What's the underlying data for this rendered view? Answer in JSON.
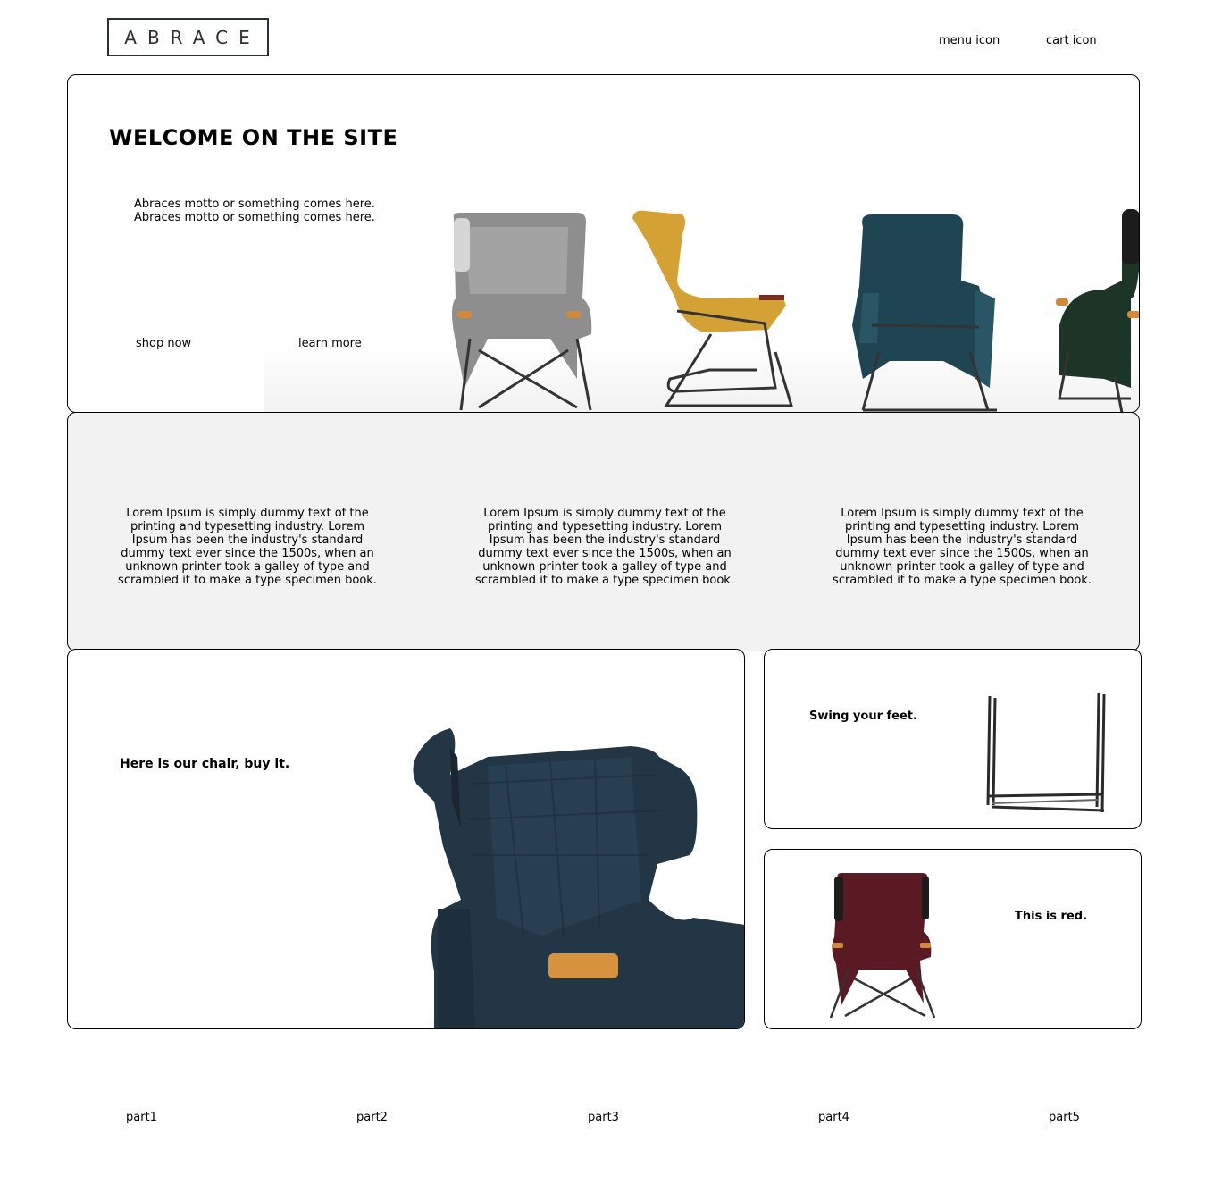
{
  "header": {
    "logo_text": "ABRACE",
    "menu_label": "menu icon",
    "cart_label": "cart icon"
  },
  "hero": {
    "title": "WELCOME ON THE SITE",
    "motto": "Abraces motto or something comes here.\nAbraces motto or something comes here.",
    "shop_now": "shop now",
    "learn_more": "learn more",
    "chair_colors": [
      "#8e8e8e",
      "#d4a134",
      "#1f4452",
      "#1d3527"
    ]
  },
  "features": [
    {
      "text": "Lorem Ipsum is simply dummy text of the printing and typesetting industry. Lorem Ipsum has been the industry's standard dummy text ever since the 1500s, when an unknown printer took a galley of type and scrambled it to make a type specimen book."
    },
    {
      "text": "Lorem Ipsum is simply dummy text of the printing and typesetting industry. Lorem Ipsum has been the industry's standard dummy text ever since the 1500s, when an unknown printer took a galley of type and scrambled it to make a type specimen book."
    },
    {
      "text": "Lorem Ipsum is simply dummy text of the printing and typesetting industry. Lorem Ipsum has been the industry's standard dummy text ever since the 1500s, when an unknown printer took a galley of type and scrambled it to make a type specimen book."
    }
  ],
  "cards": {
    "big_title": "Here is our chair, buy it.",
    "swing_title": "Swing your feet.",
    "red_title": "This is red.",
    "big_chair_color": "#233646",
    "red_chair_color": "#5a1a24"
  },
  "footer": {
    "links": [
      "part1",
      "part2",
      "part3",
      "part4",
      "part5"
    ]
  }
}
